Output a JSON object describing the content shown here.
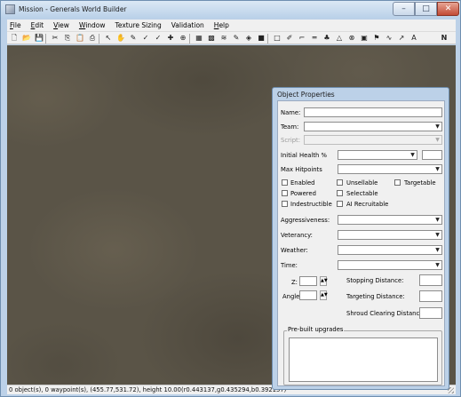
{
  "window": {
    "title": "Mission - Generals World Builder"
  },
  "menu": [
    {
      "label": "File",
      "key": "F",
      "rest": "ile"
    },
    {
      "label": "Edit",
      "key": "E",
      "rest": "dit"
    },
    {
      "label": "View",
      "key": "V",
      "rest": "iew"
    },
    {
      "label": "Window",
      "key": "W",
      "rest": "indow"
    },
    {
      "label": "Texture Sizing",
      "key": "",
      "rest": "Texture Sizing"
    },
    {
      "label": "Validation",
      "key": "",
      "rest": "Validation"
    },
    {
      "label": "Help",
      "key": "H",
      "rest": "elp"
    }
  ],
  "toolbar_icons": [
    "new-icon",
    "open-icon",
    "save-icon",
    "cut-icon",
    "copy-icon",
    "paste-icon",
    "print-icon",
    "pointer-icon",
    "hand-icon",
    "brush-icon",
    "check-icon",
    "check-icon",
    "plus-icon",
    "select-icon",
    "grid-icon",
    "checker-icon",
    "pattern-icon",
    "brush-icon",
    "paint-bucket-icon",
    "square-icon",
    "rectangle-icon",
    "pen-icon",
    "line-icon",
    "road-icon",
    "tree-icon",
    "triangle-icon",
    "circle-icon",
    "image-icon",
    "flag-icon",
    "curve-icon",
    "arrow-icon",
    "text-icon",
    "n-icon"
  ],
  "status": {
    "text": "0 object(s), 0 waypoint(s), (455.77,531.72), height 10.00(r0.443137,g0.435294,b0.392157)"
  },
  "props": {
    "title": "Object Properties",
    "name_label": "Name:",
    "team_label": "Team:",
    "script_label": "Script:",
    "initial_health_label": "Initial Health %",
    "max_hitpoints_label": "Max Hitpoints",
    "checkboxes": {
      "enabled": "Enabled",
      "unsellable": "Unsellable",
      "targetable": "Targetable",
      "powered": "Powered",
      "selectable": "Selectable",
      "indestructible": "Indestructible",
      "ai_recruitable": "AI Recruitable"
    },
    "aggressiveness_label": "Aggressiveness:",
    "veterancy_label": "Veterancy:",
    "weather_label": "Weather:",
    "time_label": "Time:",
    "z_label": "Z:",
    "angle_label": "Angle:",
    "stopping_distance_label": "Stopping Distance:",
    "targeting_distance_label": "Targeting Distance:",
    "shroud_distance_label": "Shroud Clearing Distance:",
    "prebuilt_label": "Pre-built upgrades"
  }
}
